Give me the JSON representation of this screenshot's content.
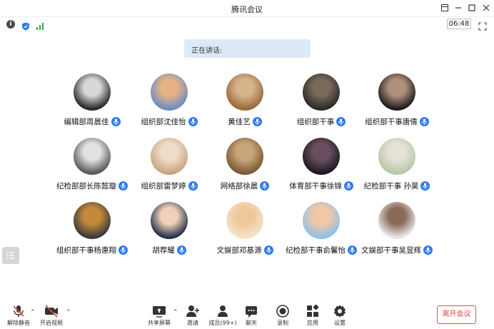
{
  "window": {
    "title": "腾讯会议"
  },
  "status": {
    "timer": "06:48"
  },
  "speaking": {
    "label": "正在讲话:"
  },
  "participants": [
    {
      "name": "编辑部周晨佳",
      "colors": [
        "#2a2a2a",
        "#d8d8d8"
      ]
    },
    {
      "name": "组织部沈佳怡",
      "colors": [
        "#6b8ec4",
        "#e7b184"
      ]
    },
    {
      "name": "黄佳艺",
      "colors": [
        "#9a6b3e",
        "#d7b48a"
      ]
    },
    {
      "name": "组织部干事",
      "colors": [
        "#2b2b2b",
        "#7a6a5a"
      ]
    },
    {
      "name": "组织部干事唐倩",
      "colors": [
        "#1e1e1e",
        "#b08f7c"
      ]
    },
    {
      "name": "纪检部部长陈懿璇",
      "colors": [
        "#5a5a5a",
        "#e2e2e2"
      ]
    },
    {
      "name": "组织部雷梦婷",
      "colors": [
        "#c8a583",
        "#f1dcc7"
      ]
    },
    {
      "name": "网络部徐晨",
      "colors": [
        "#7a5a35",
        "#c9a57a"
      ]
    },
    {
      "name": "体育部干事徐锦",
      "colors": [
        "#1d1a24",
        "#6b4e5e"
      ]
    },
    {
      "name": "纪检部干事 孙昊",
      "colors": [
        "#b8c9a8",
        "#e6e1d6"
      ]
    },
    {
      "name": "组织部干事杨惠翔",
      "colors": [
        "#3b3b3b",
        "#c48a3c"
      ]
    },
    {
      "name": "胡荐耀",
      "colors": [
        "#26324d",
        "#f0d0b8"
      ]
    },
    {
      "name": "文娱部邓基源",
      "colors": [
        "#f4e4c8",
        "#f0c79a"
      ]
    },
    {
      "name": "纪检部干事俞馨怡",
      "colors": [
        "#8fc2e8",
        "#f2c7a3"
      ]
    },
    {
      "name": "文娱部干事吴昱辉",
      "colors": [
        "#e8e8e8",
        "#8a6a58"
      ]
    }
  ],
  "toolbar": {
    "unmute": "解除静音",
    "start_video": "开启视频",
    "share": "共享屏幕",
    "invite": "邀请",
    "members": "成员(99+)",
    "chat": "聊天",
    "record": "录制",
    "apps": "应用",
    "settings": "设置",
    "leave": "离开会议"
  },
  "colors": {
    "accent": "#2e7bf0",
    "danger": "#e04545",
    "speaking_bg": "#dceaf8"
  }
}
